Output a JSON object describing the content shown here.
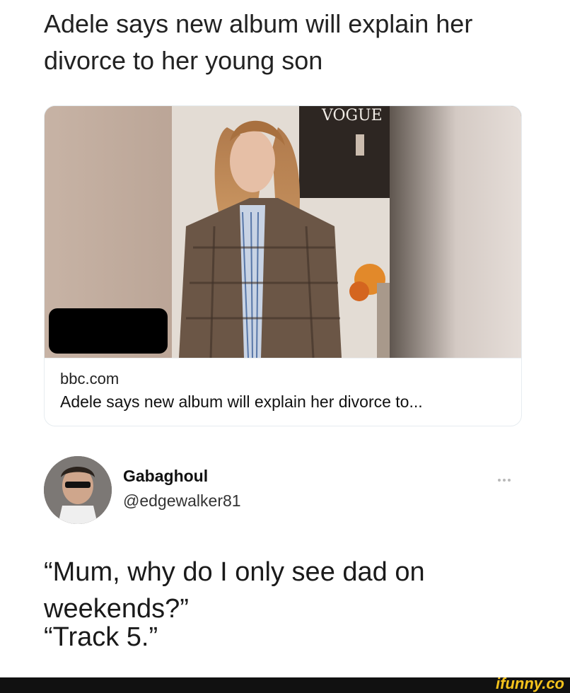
{
  "headline": {
    "line1": "Adele says new album will explain her",
    "line2": "divorce to her young son"
  },
  "link_card": {
    "image_icon": "photo-image",
    "magazine_logo": "VOGUE",
    "domain": "bbc.com",
    "title": "Adele says new album will explain her divorce to..."
  },
  "tweet": {
    "author_name": "Gabaghoul",
    "author_handle": "@edgewalker81",
    "more_icon": "more-options-icon",
    "line1": "“Mum, why do I only see dad on",
    "line2": "weekends?”",
    "line3": "“Track 5.”"
  },
  "watermark": {
    "brand": "ifunny.co"
  },
  "colors": {
    "text": "#14171a",
    "brand_yellow": "#f6c31c",
    "bar": "#111111"
  }
}
